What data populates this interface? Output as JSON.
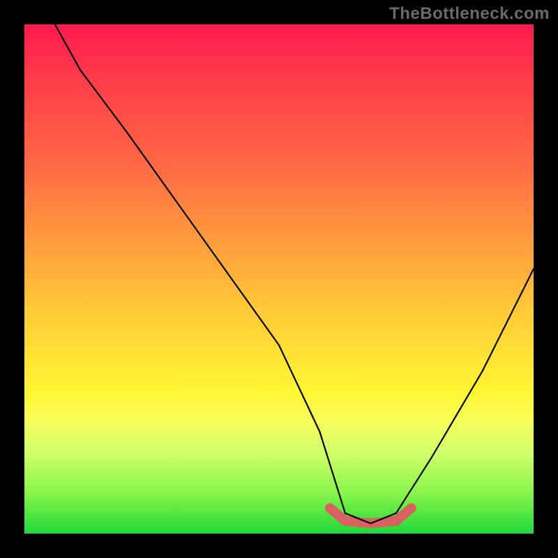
{
  "watermark": "TheBottleneck.com",
  "colors": {
    "frame": "#000000",
    "gradient_stops": [
      "#ff1a4d",
      "#ff6a44",
      "#ffc938",
      "#fff532",
      "#1fd83a"
    ],
    "curve": "#000000",
    "bump": "#d8625f"
  },
  "chart_data": {
    "type": "line",
    "title": "",
    "xlabel": "",
    "ylabel": "",
    "xlim": [
      0,
      100
    ],
    "ylim": [
      0,
      100
    ],
    "note": "No numeric axes or ticks shown. V-shaped curve overlaid on gradient; minimum plateau roughly x≈63–73 at y≈2. Left branch starts near (6,100) with slight convex kink around x≈11; right branch rises to ≈(100,52).",
    "series": [
      {
        "name": "curve",
        "color": "#000000",
        "x": [
          6,
          11,
          20,
          35,
          50,
          58,
          63,
          68,
          73,
          80,
          90,
          100
        ],
        "y": [
          100,
          91,
          79,
          58,
          37,
          20,
          4,
          2,
          4,
          15,
          32,
          52
        ]
      }
    ],
    "highlight_segment": {
      "name": "bump",
      "color": "#d8625f",
      "x": [
        60,
        63,
        68,
        73,
        76
      ],
      "y": [
        5,
        2.5,
        2,
        2.5,
        5
      ]
    }
  }
}
